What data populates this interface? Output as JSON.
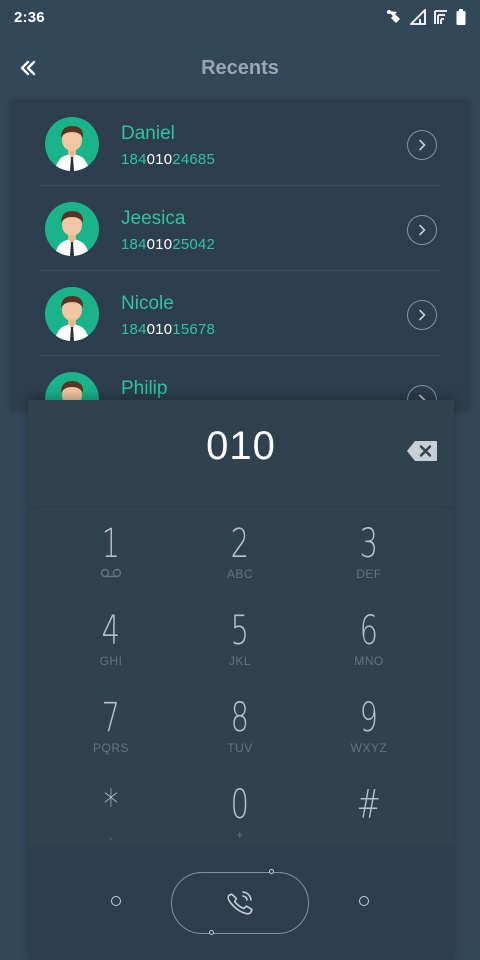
{
  "status_bar": {
    "time": "2:36"
  },
  "app_bar": {
    "title": "Recents"
  },
  "recents": [
    {
      "name": "Daniel",
      "number_prefix": "184",
      "number_match": "010",
      "number_suffix": "24685"
    },
    {
      "name": "Jeesica",
      "number_prefix": "184",
      "number_match": "010",
      "number_suffix": "25042"
    },
    {
      "name": "Nicole",
      "number_prefix": "184",
      "number_match": "010",
      "number_suffix": "15678"
    },
    {
      "name": "Philip",
      "number_prefix": "",
      "number_match": "",
      "number_suffix": ""
    }
  ],
  "dialer": {
    "dialed": "010",
    "keys": [
      {
        "digit": "1",
        "letters": ""
      },
      {
        "digit": "2",
        "letters": "ABC"
      },
      {
        "digit": "3",
        "letters": "DEF"
      },
      {
        "digit": "4",
        "letters": "GHI"
      },
      {
        "digit": "5",
        "letters": "JKL"
      },
      {
        "digit": "6",
        "letters": "MNO"
      },
      {
        "digit": "7",
        "letters": "PQRS"
      },
      {
        "digit": "8",
        "letters": "TUV"
      },
      {
        "digit": "9",
        "letters": "WXYZ"
      },
      {
        "digit": "*",
        "letters": ","
      },
      {
        "digit": "0",
        "letters": "+"
      },
      {
        "digit": "#",
        "letters": ""
      }
    ]
  },
  "colors": {
    "background": "#33475a",
    "accent": "#2ec4a0",
    "avatar_bg": "#1ab38a",
    "text_primary": "#ffffff",
    "text_muted": "#67737f"
  },
  "icons": {
    "back": "double-chevron-left-icon",
    "backspace": "backspace-icon",
    "call": "phone-icon",
    "detail": "chevron-right-circle-icon",
    "voicemail": "voicemail-icon"
  }
}
